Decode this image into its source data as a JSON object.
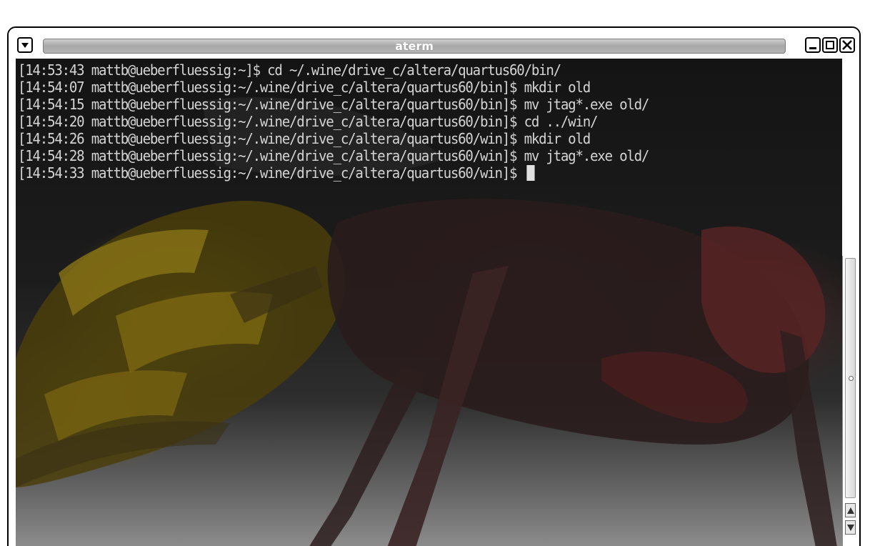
{
  "window": {
    "title": "aterm",
    "menu_icon": "chevron-down-icon",
    "buttons": [
      "minimize-icon",
      "maximize-icon",
      "close-icon"
    ]
  },
  "terminal": {
    "lines": [
      "[14:53:43 mattb@ueberfluessig:~]$ cd ~/.wine/drive_c/altera/quartus60/bin/",
      "[14:54:07 mattb@ueberfluessig:~/.wine/drive_c/altera/quartus60/bin]$ mkdir old",
      "[14:54:15 mattb@ueberfluessig:~/.wine/drive_c/altera/quartus60/bin]$ mv jtag*.exe old/",
      "[14:54:20 mattb@ueberfluessig:~/.wine/drive_c/altera/quartus60/bin]$ cd ../win/",
      "[14:54:26 mattb@ueberfluessig:~/.wine/drive_c/altera/quartus60/win]$ mkdir old",
      "[14:54:28 mattb@ueberfluessig:~/.wine/drive_c/altera/quartus60/win]$ mv jtag*.exe old/",
      "[14:54:33 mattb@ueberfluessig:~/.wine/drive_c/altera/quartus60/win]$ "
    ]
  },
  "colors": {
    "terminal_text": "#d4d4d4",
    "titlebar_track": "#b4b4b4",
    "title_text": "#ffffff"
  }
}
